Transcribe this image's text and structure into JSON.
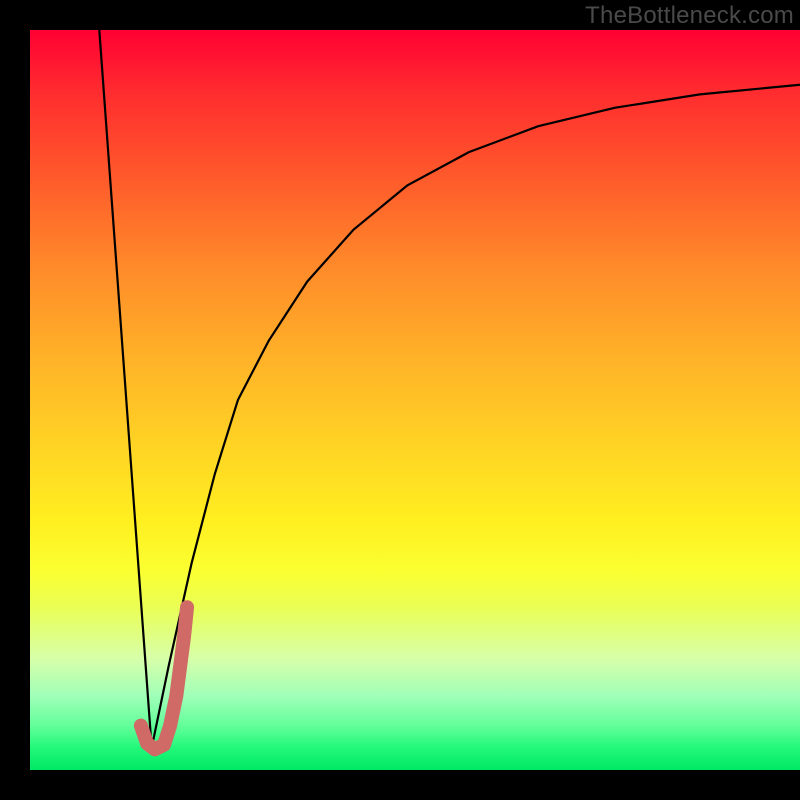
{
  "watermark": "TheBottleneck.com",
  "chart_data": {
    "type": "line",
    "title": "",
    "xlabel": "",
    "ylabel": "",
    "xlim": [
      0,
      100
    ],
    "ylim": [
      0,
      100
    ],
    "series": [
      {
        "name": "left-descent",
        "x": [
          9,
          15.8
        ],
        "y": [
          100,
          3
        ]
      },
      {
        "name": "right-curve",
        "x": [
          15.8,
          18,
          21,
          24,
          27,
          31,
          36,
          42,
          49,
          57,
          66,
          76,
          87,
          100
        ],
        "y": [
          3,
          14,
          28,
          40,
          50,
          58,
          66,
          73,
          79,
          83.5,
          87,
          89.5,
          91.3,
          92.6
        ]
      },
      {
        "name": "j-highlight",
        "x": [
          14.4,
          15.2,
          16.2,
          17.4,
          18.2,
          19.0,
          19.5,
          20.0,
          20.4
        ],
        "y": [
          6.0,
          3.6,
          2.8,
          3.4,
          6.0,
          10.0,
          14.0,
          18.0,
          22.0
        ]
      }
    ],
    "colors": {
      "left-descent": "#000000",
      "right-curve": "#000000",
      "j-highlight": "#cf6a66"
    }
  }
}
